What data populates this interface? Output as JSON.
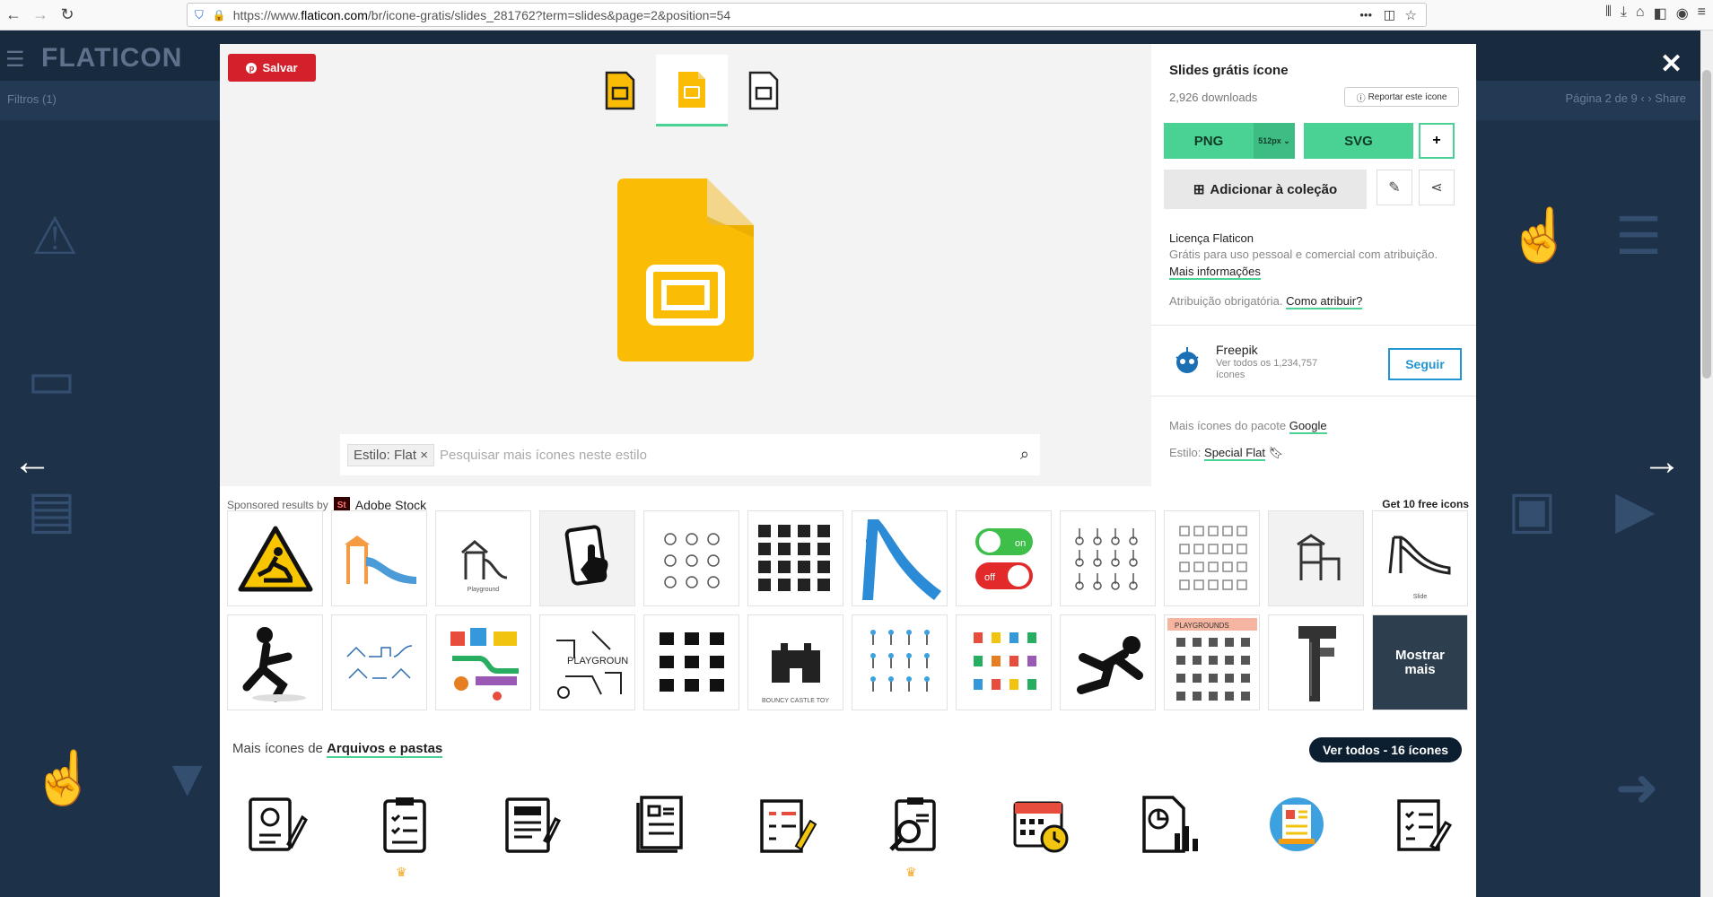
{
  "browser": {
    "url_prefix": "https://www.",
    "url_domain": "flaticon.com",
    "url_rest": "/br/icone-gratis/slides_281762?term=slides&page=2&position=54",
    "dots": "•••"
  },
  "backdrop": {
    "logo": "FLATICON",
    "filters": "Filtros (1)",
    "page_label": "Página",
    "page_num": "2",
    "page_of": "de 9",
    "share": "Share"
  },
  "modal": {
    "save_label": "Salvar",
    "title": "Slides grátis ícone",
    "downloads": "2,926 downloads",
    "report": "Reportar este ícone",
    "png": "PNG",
    "png_size": "512px",
    "svg": "SVG",
    "plus": "+",
    "add_collection": "Adicionar à coleção",
    "license_title": "Licença Flaticon",
    "license_desc": "Grátis para uso pessoal e comercial com atribuição.",
    "more_info": "Mais informações",
    "attribution": "Atribuição obrigatória.",
    "how_attribute": "Como atribuir?",
    "author_name": "Freepik",
    "author_sub": "Ver todos os 1,234,757 ícones",
    "follow": "Seguir",
    "pack_prefix": "Mais ícones do pacote",
    "pack_name": "Google",
    "style_prefix": "Estilo:",
    "style_name": "Special Flat",
    "style_chip": "Estilo: Flat",
    "style_chip_x": "×",
    "search_placeholder": "Pesquisar mais ícones neste estilo",
    "sponsored_prefix": "Sponsored results by",
    "stock_logo": "St",
    "stock_name": "Adobe Stock",
    "get_free": "Get 10 free icons",
    "cap_playground": "Playground",
    "cap_slide": "Slide",
    "cap_playgrounds": "PLAYGROUNDS",
    "cap_bouncy": "BOUNCY CASTLE TOY",
    "toggle_on": "on",
    "toggle_off": "off",
    "show_more": "Mostrar mais",
    "more_prefix": "Mais ícones de",
    "more_category": "Arquivos e pastas",
    "see_all": "Ver todos - 16 ícones"
  },
  "colors": {
    "accent": "#4ad295",
    "slides_yellow": "#fbbc05",
    "save_red": "#d4202a",
    "follow_blue": "#2196d3"
  }
}
